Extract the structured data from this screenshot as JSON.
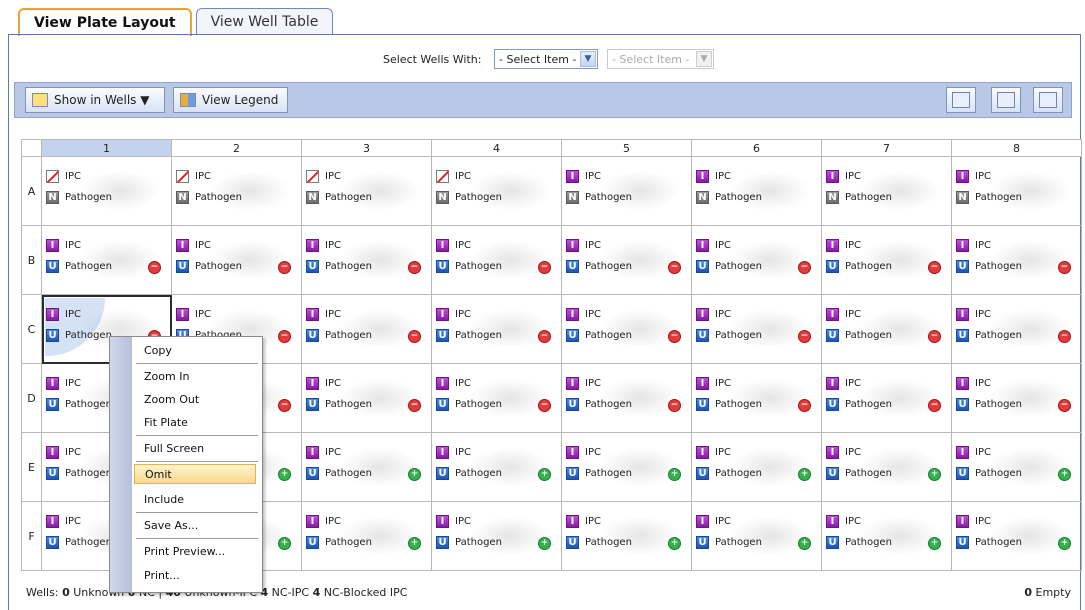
{
  "tabs": [
    {
      "label": "View Plate Layout",
      "active": true
    },
    {
      "label": "View Well Table",
      "active": false
    }
  ],
  "select_wells": {
    "label": "Select Wells With:",
    "combo1": "- Select Item -",
    "combo2": "- Select Item -"
  },
  "toolbar": {
    "show_in_wells": "Show in Wells ▼",
    "view_legend": "View Legend",
    "icons": [
      "zoom-in-plate-icon",
      "zoom-out-plate-icon",
      "fit-plate-icon"
    ]
  },
  "plate": {
    "columns": [
      "1",
      "2",
      "3",
      "4",
      "5",
      "6",
      "7",
      "8"
    ],
    "selected_column": 0,
    "rows": [
      {
        "label": "A",
        "target1": "IPC",
        "target2": "Pathogen",
        "badge1": [
          "x",
          "x",
          "x",
          "x",
          "i",
          "i",
          "i",
          "i"
        ],
        "badge2": "n",
        "status": "none"
      },
      {
        "label": "B",
        "target1": "IPC",
        "target2": "Pathogen",
        "badge1": [
          "i",
          "i",
          "i",
          "i",
          "i",
          "i",
          "i",
          "i"
        ],
        "badge2": "u",
        "status": "neg"
      },
      {
        "label": "C",
        "target1": "IPC",
        "target2": "Pathogen",
        "badge1": [
          "i",
          "i",
          "i",
          "i",
          "i",
          "i",
          "i",
          "i"
        ],
        "badge2": "u",
        "status": "neg"
      },
      {
        "label": "D",
        "target1": "IPC",
        "target2": "Pathogen",
        "badge1": [
          "i",
          "i",
          "i",
          "i",
          "i",
          "i",
          "i",
          "i"
        ],
        "badge2": "u",
        "status": "neg"
      },
      {
        "label": "E",
        "target1": "IPC",
        "target2": "Pathogen",
        "badge1": [
          "i",
          "i",
          "i",
          "i",
          "i",
          "i",
          "i",
          "i"
        ],
        "badge2": "u",
        "status": "pos"
      },
      {
        "label": "F",
        "target1": "IPC",
        "target2": "Pathogen",
        "badge1": [
          "i",
          "i",
          "i",
          "i",
          "i",
          "i",
          "i",
          "i"
        ],
        "badge2": "u",
        "status": "pos"
      }
    ],
    "badge_letters": {
      "i": "I",
      "u": "U",
      "n": "N",
      "x": ""
    },
    "status_glyphs": {
      "neg": "−",
      "pos": "+"
    }
  },
  "context_menu": {
    "items": [
      "Copy",
      "Zoom In",
      "Zoom Out",
      "Fit Plate",
      "Full Screen",
      "Omit",
      "Include",
      "Save As...",
      "Print Preview...",
      "Print..."
    ],
    "highlighted": "Omit"
  },
  "status": {
    "wells_label": "Wells:",
    "unknown_count": "0",
    "unknown_label": "Unknown",
    "nc_count": "0",
    "nc_label": "NC",
    "sep": "|",
    "unknown_ipc_count": "40",
    "unknown_ipc_label": "Unknown-IPC",
    "nc_ipc_count": "4",
    "nc_ipc_label": "NC-IPC",
    "nc_blocked_count": "4",
    "nc_blocked_label": "NC-Blocked IPC",
    "empty_count": "0",
    "empty_label": "Empty"
  },
  "colors": {
    "accent_tab": "#e8a13b",
    "toolbar": "#b9c8e6",
    "badge_ipc": "#8a1aa6",
    "badge_unknown": "#1b56b5",
    "status_neg": "#32b24a",
    "status_pos": "#e23b3b"
  }
}
